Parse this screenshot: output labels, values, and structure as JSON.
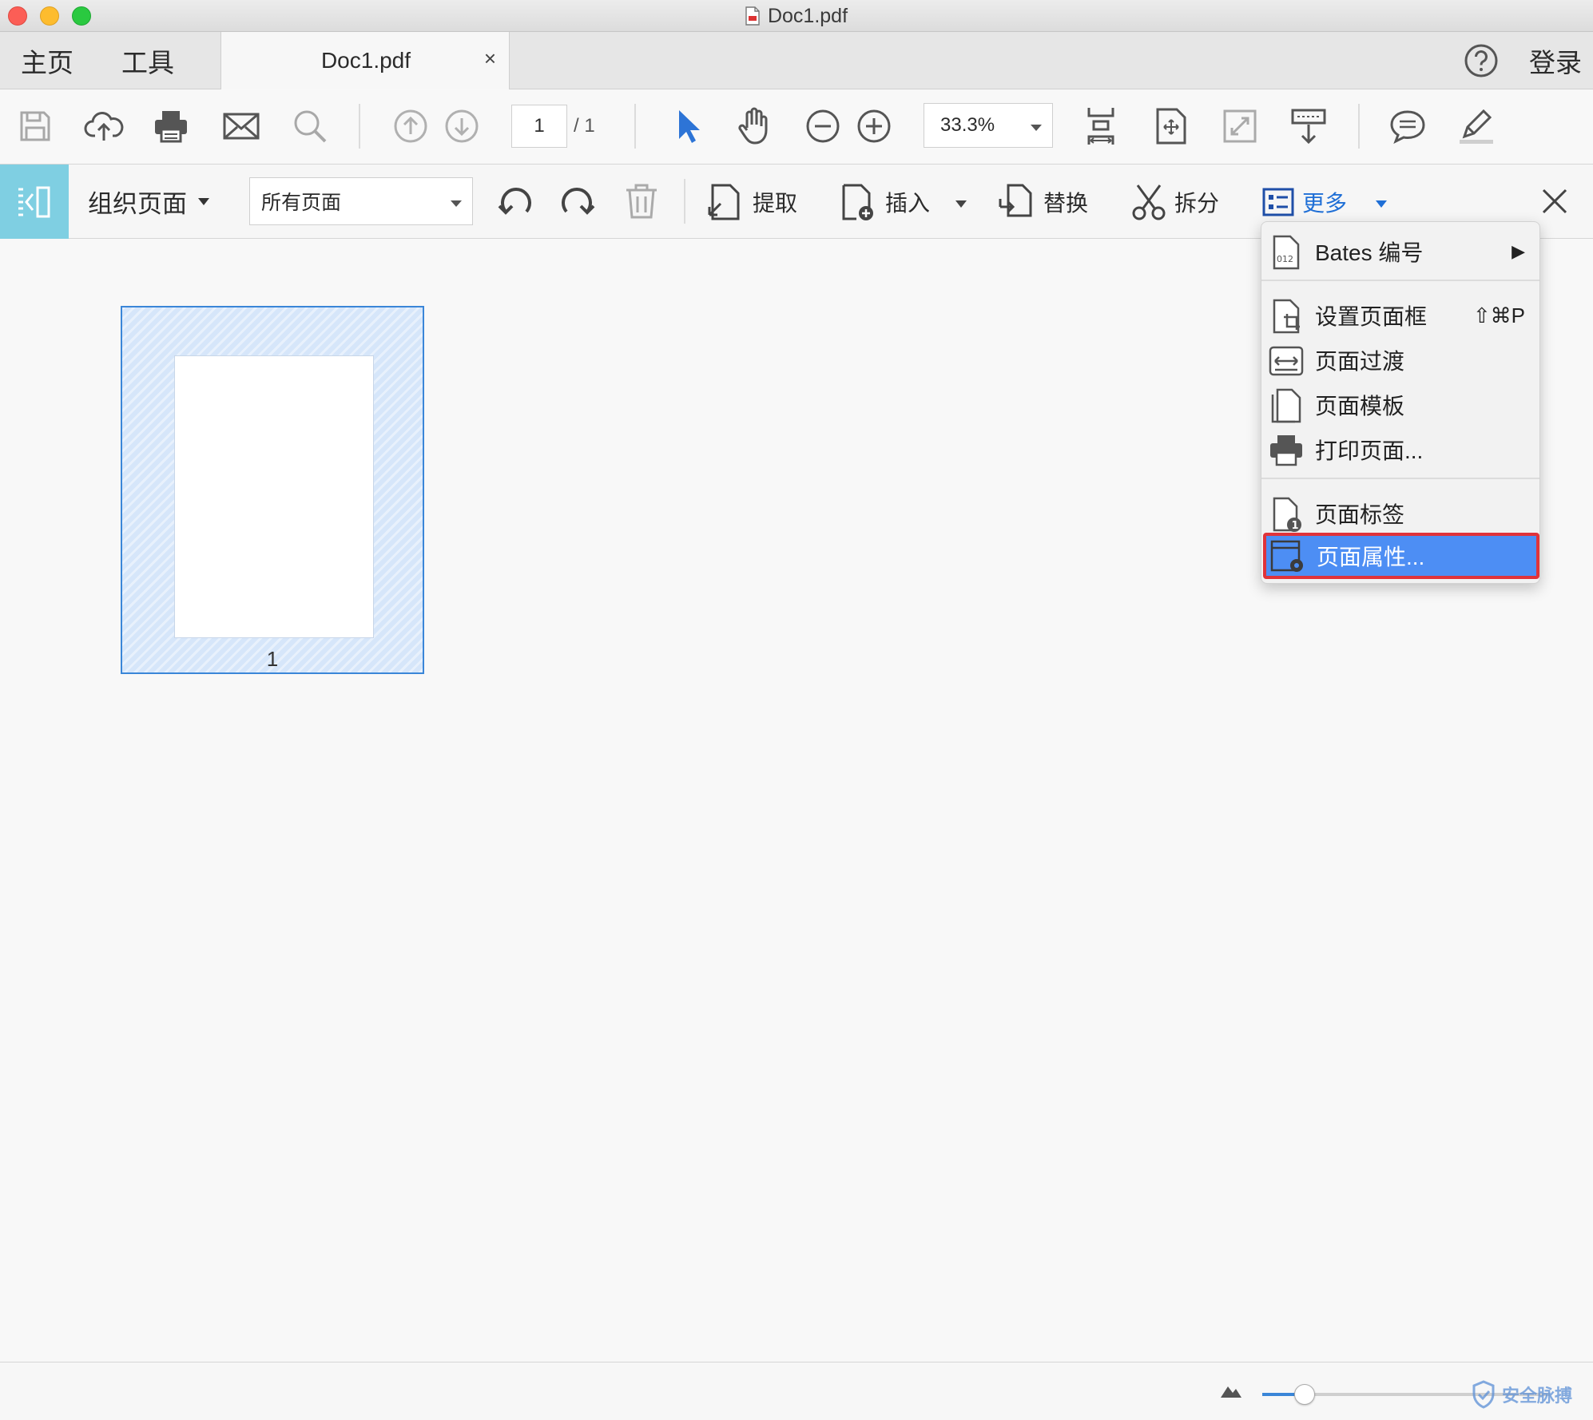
{
  "window": {
    "title": "Doc1.pdf"
  },
  "tabs": {
    "home": "主页",
    "tools": "工具",
    "document": "Doc1.pdf",
    "close_glyph": "×"
  },
  "header_right": {
    "login": "登录"
  },
  "toolbar": {
    "page_current": "1",
    "page_total": "/ 1",
    "zoom": "33.3%",
    "icons": [
      "save-icon",
      "upload-icon",
      "print-icon",
      "mail-icon",
      "search-icon",
      "page-up-icon",
      "page-down-icon",
      "select-arrow-icon",
      "hand-icon",
      "zoom-out-icon",
      "zoom-in-icon",
      "fit-page-icon",
      "rotate-view-icon",
      "fullscreen-icon",
      "scroll-mode-icon",
      "comment-icon",
      "pen-icon"
    ]
  },
  "organize": {
    "title": "组织页面",
    "range": "所有页面",
    "extract": "提取",
    "insert": "插入",
    "replace": "替换",
    "split": "拆分",
    "more": "更多"
  },
  "thumbnail": {
    "page_number": "1"
  },
  "menu": {
    "items": [
      {
        "label": "Bates 编号",
        "submenu_glyph": "▶"
      },
      {
        "label": "设置页面框",
        "shortcut": "⇧⌘P"
      },
      {
        "label": "页面过渡"
      },
      {
        "label": "页面模板"
      },
      {
        "label": "打印页面..."
      },
      {
        "label": "页面标签"
      },
      {
        "label": "页面属性..."
      }
    ],
    "bates_icon_text": "012",
    "label_badge": "1"
  },
  "status": {
    "watermark": "安全脉搏"
  },
  "colors": {
    "accent": "#3a86d8",
    "highlight": "#4d8ef4",
    "outline": "#e0333a",
    "org_icon_bg": "#7fcfe2"
  }
}
